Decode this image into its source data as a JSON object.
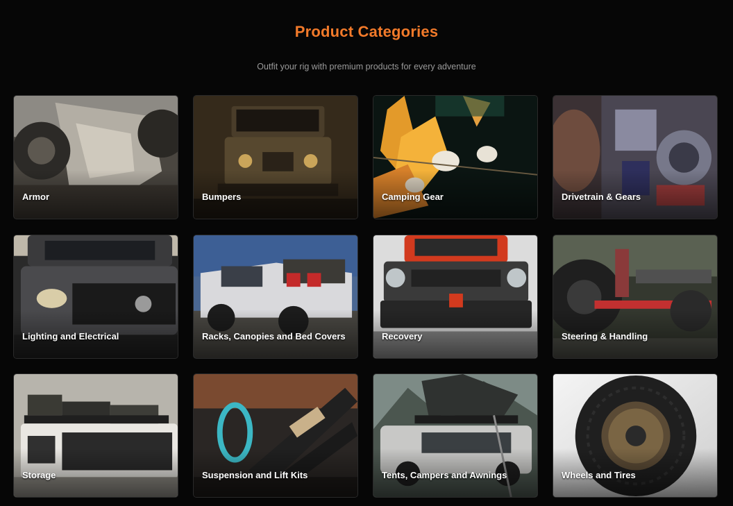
{
  "header": {
    "title": "Product Categories",
    "subtitle": "Outfit your rig with premium products for every adventure"
  },
  "colors": {
    "accent": "#f27a2a",
    "background": "#060606",
    "subtitle": "#9a9a9a"
  },
  "categories": [
    {
      "label": "Armor"
    },
    {
      "label": "Bumpers"
    },
    {
      "label": "Camping Gear"
    },
    {
      "label": "Drivetrain & Gears"
    },
    {
      "label": "Lighting and Electrical"
    },
    {
      "label": "Racks, Canopies and Bed Covers"
    },
    {
      "label": "Recovery"
    },
    {
      "label": "Steering & Handling"
    },
    {
      "label": "Storage"
    },
    {
      "label": "Suspension and Lift Kits"
    },
    {
      "label": "Tents, Campers and Awnings"
    },
    {
      "label": "Wheels and Tires"
    }
  ]
}
